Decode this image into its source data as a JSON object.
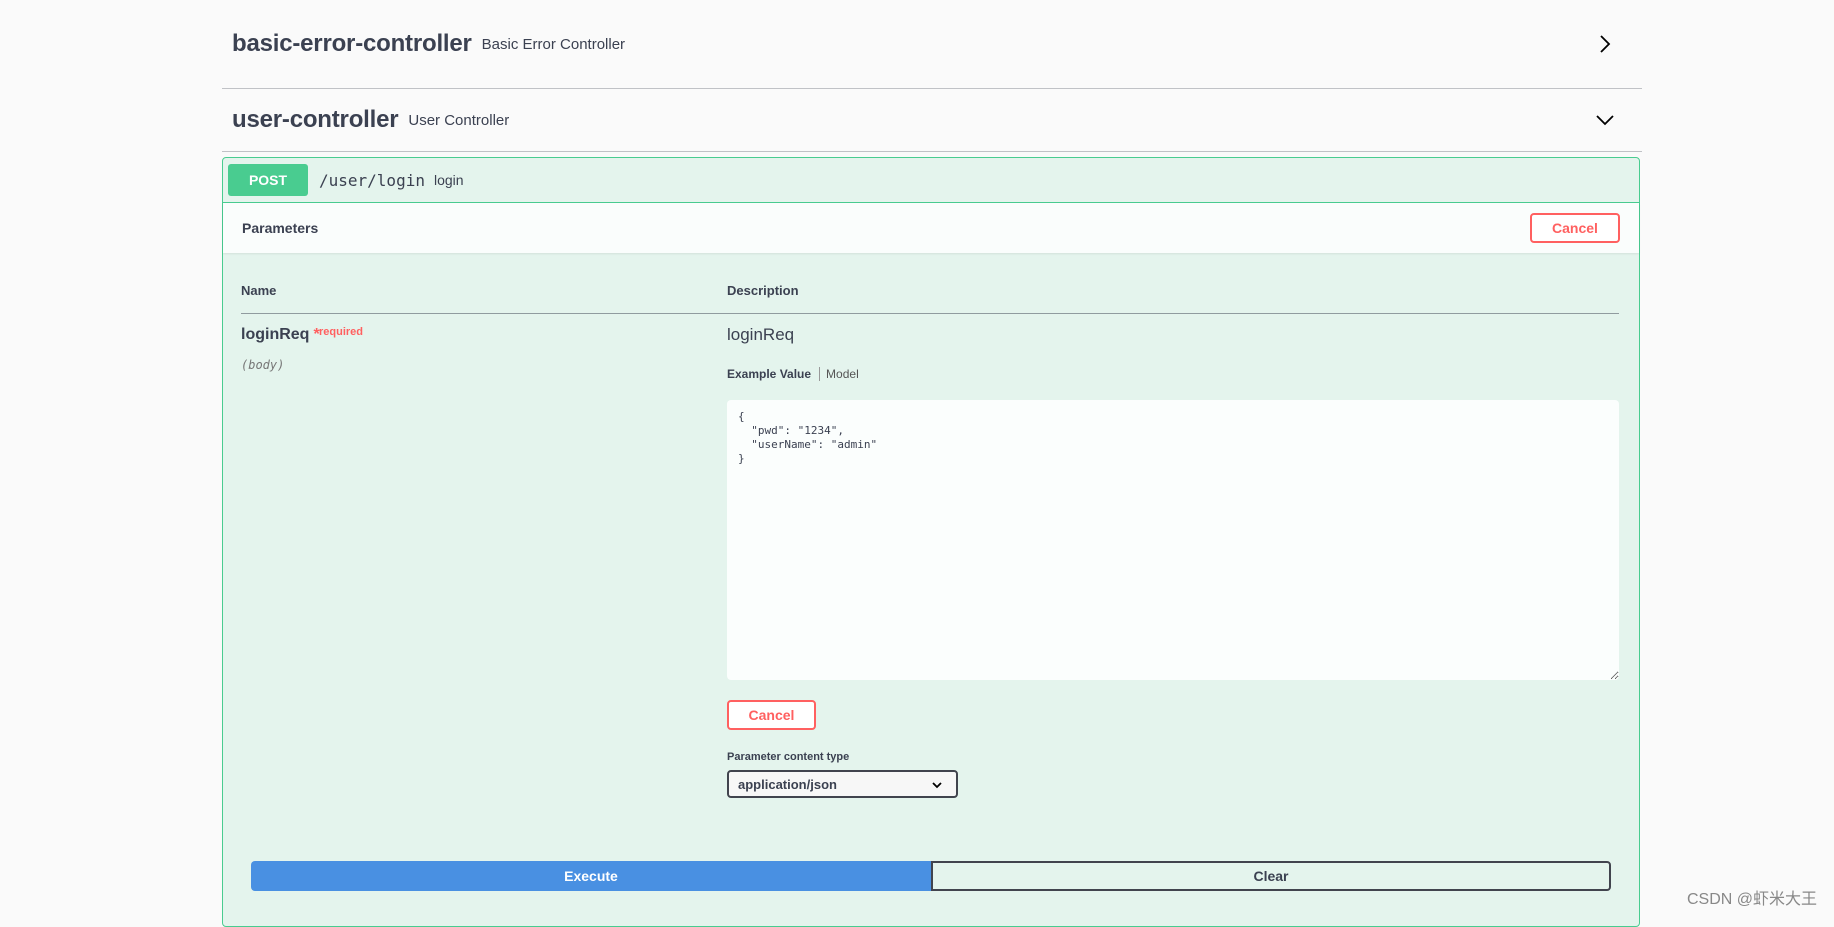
{
  "tags": [
    {
      "name": "basic-error-controller",
      "description": "Basic Error Controller",
      "toggle_icon": "chevron-right-icon"
    },
    {
      "name": "user-controller",
      "description": "User Controller",
      "toggle_icon": "chevron-down-icon"
    }
  ],
  "operation": {
    "method": "POST",
    "path": "/user/login",
    "summary": "login",
    "parameters_title": "Parameters",
    "cancel_label": "Cancel",
    "columns": {
      "name": "Name",
      "description": "Description"
    },
    "param": {
      "name": "loginReq",
      "star": "*",
      "required_label": "required",
      "in": "(body)",
      "description": "loginReq",
      "tab_example": "Example Value",
      "tab_model": "Model",
      "body_value": "{\n  \"pwd\": \"1234\",\n  \"userName\": \"admin\"\n}"
    },
    "inline_cancel_label": "Cancel",
    "content_type_label": "Parameter content type",
    "content_type_value": "application/json",
    "execute_label": "Execute",
    "clear_label": "Clear"
  },
  "watermark": "CSDN @虾米大王",
  "colors": {
    "post": "#49cc90",
    "execute": "#4990e2",
    "cancel": "#ff6060"
  }
}
